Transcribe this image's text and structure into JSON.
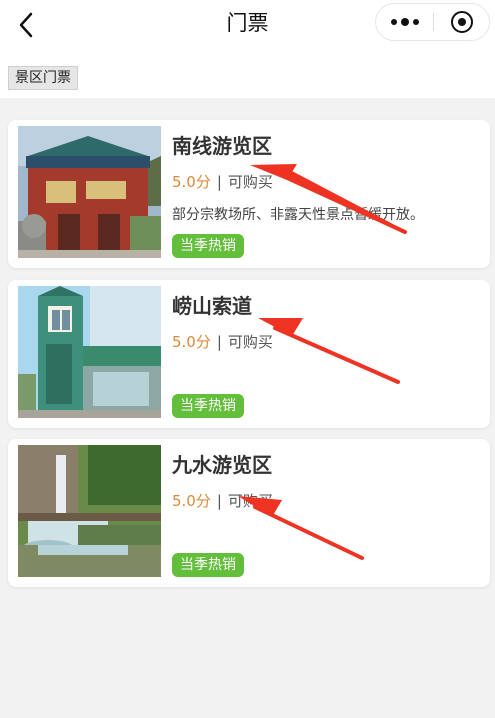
{
  "header": {
    "title": "门票"
  },
  "section": {
    "tag": "景区门票"
  },
  "items": [
    {
      "name": "南线游览区",
      "score": "5.0分",
      "status": "可购买",
      "note": "部分宗教场所、非露天性景点暂缓开放。",
      "badge": "当季热销"
    },
    {
      "name": "崂山索道",
      "score": "5.0分",
      "status": "可购买",
      "note": "",
      "badge": "当季热销"
    },
    {
      "name": "九水游览区",
      "score": "5.0分",
      "status": "可购买",
      "note": "",
      "badge": "当季热销"
    }
  ],
  "colors": {
    "accent": "#e0893a",
    "badge": "#63be3c",
    "annotation": "#ee3322"
  },
  "icons": [
    "back-arrow-icon",
    "more-dots-icon",
    "close-target-icon"
  ]
}
